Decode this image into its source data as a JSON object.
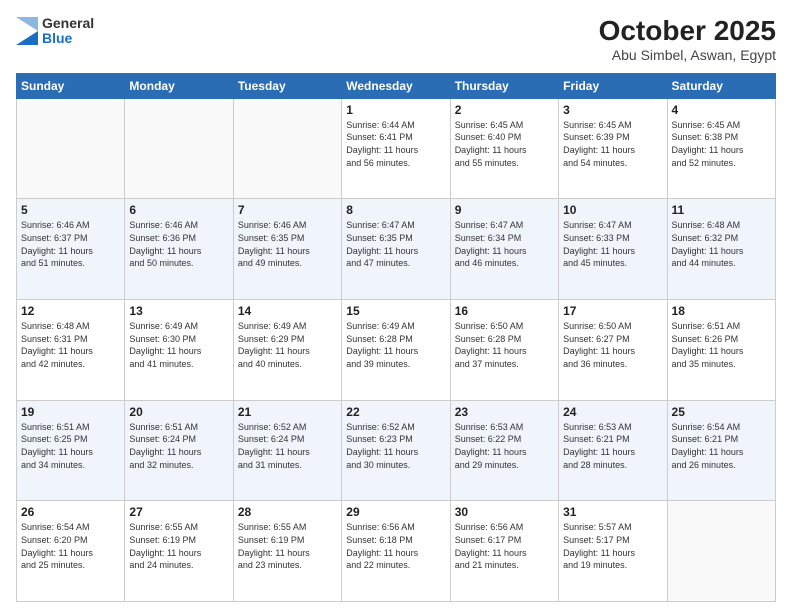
{
  "header": {
    "logo_general": "General",
    "logo_blue": "Blue",
    "month_title": "October 2025",
    "subtitle": "Abu Simbel, Aswan, Egypt"
  },
  "calendar": {
    "days_of_week": [
      "Sunday",
      "Monday",
      "Tuesday",
      "Wednesday",
      "Thursday",
      "Friday",
      "Saturday"
    ],
    "weeks": [
      [
        {
          "day": "",
          "info": ""
        },
        {
          "day": "",
          "info": ""
        },
        {
          "day": "",
          "info": ""
        },
        {
          "day": "1",
          "info": "Sunrise: 6:44 AM\nSunset: 6:41 PM\nDaylight: 11 hours\nand 56 minutes."
        },
        {
          "day": "2",
          "info": "Sunrise: 6:45 AM\nSunset: 6:40 PM\nDaylight: 11 hours\nand 55 minutes."
        },
        {
          "day": "3",
          "info": "Sunrise: 6:45 AM\nSunset: 6:39 PM\nDaylight: 11 hours\nand 54 minutes."
        },
        {
          "day": "4",
          "info": "Sunrise: 6:45 AM\nSunset: 6:38 PM\nDaylight: 11 hours\nand 52 minutes."
        }
      ],
      [
        {
          "day": "5",
          "info": "Sunrise: 6:46 AM\nSunset: 6:37 PM\nDaylight: 11 hours\nand 51 minutes."
        },
        {
          "day": "6",
          "info": "Sunrise: 6:46 AM\nSunset: 6:36 PM\nDaylight: 11 hours\nand 50 minutes."
        },
        {
          "day": "7",
          "info": "Sunrise: 6:46 AM\nSunset: 6:35 PM\nDaylight: 11 hours\nand 49 minutes."
        },
        {
          "day": "8",
          "info": "Sunrise: 6:47 AM\nSunset: 6:35 PM\nDaylight: 11 hours\nand 47 minutes."
        },
        {
          "day": "9",
          "info": "Sunrise: 6:47 AM\nSunset: 6:34 PM\nDaylight: 11 hours\nand 46 minutes."
        },
        {
          "day": "10",
          "info": "Sunrise: 6:47 AM\nSunset: 6:33 PM\nDaylight: 11 hours\nand 45 minutes."
        },
        {
          "day": "11",
          "info": "Sunrise: 6:48 AM\nSunset: 6:32 PM\nDaylight: 11 hours\nand 44 minutes."
        }
      ],
      [
        {
          "day": "12",
          "info": "Sunrise: 6:48 AM\nSunset: 6:31 PM\nDaylight: 11 hours\nand 42 minutes."
        },
        {
          "day": "13",
          "info": "Sunrise: 6:49 AM\nSunset: 6:30 PM\nDaylight: 11 hours\nand 41 minutes."
        },
        {
          "day": "14",
          "info": "Sunrise: 6:49 AM\nSunset: 6:29 PM\nDaylight: 11 hours\nand 40 minutes."
        },
        {
          "day": "15",
          "info": "Sunrise: 6:49 AM\nSunset: 6:28 PM\nDaylight: 11 hours\nand 39 minutes."
        },
        {
          "day": "16",
          "info": "Sunrise: 6:50 AM\nSunset: 6:28 PM\nDaylight: 11 hours\nand 37 minutes."
        },
        {
          "day": "17",
          "info": "Sunrise: 6:50 AM\nSunset: 6:27 PM\nDaylight: 11 hours\nand 36 minutes."
        },
        {
          "day": "18",
          "info": "Sunrise: 6:51 AM\nSunset: 6:26 PM\nDaylight: 11 hours\nand 35 minutes."
        }
      ],
      [
        {
          "day": "19",
          "info": "Sunrise: 6:51 AM\nSunset: 6:25 PM\nDaylight: 11 hours\nand 34 minutes."
        },
        {
          "day": "20",
          "info": "Sunrise: 6:51 AM\nSunset: 6:24 PM\nDaylight: 11 hours\nand 32 minutes."
        },
        {
          "day": "21",
          "info": "Sunrise: 6:52 AM\nSunset: 6:24 PM\nDaylight: 11 hours\nand 31 minutes."
        },
        {
          "day": "22",
          "info": "Sunrise: 6:52 AM\nSunset: 6:23 PM\nDaylight: 11 hours\nand 30 minutes."
        },
        {
          "day": "23",
          "info": "Sunrise: 6:53 AM\nSunset: 6:22 PM\nDaylight: 11 hours\nand 29 minutes."
        },
        {
          "day": "24",
          "info": "Sunrise: 6:53 AM\nSunset: 6:21 PM\nDaylight: 11 hours\nand 28 minutes."
        },
        {
          "day": "25",
          "info": "Sunrise: 6:54 AM\nSunset: 6:21 PM\nDaylight: 11 hours\nand 26 minutes."
        }
      ],
      [
        {
          "day": "26",
          "info": "Sunrise: 6:54 AM\nSunset: 6:20 PM\nDaylight: 11 hours\nand 25 minutes."
        },
        {
          "day": "27",
          "info": "Sunrise: 6:55 AM\nSunset: 6:19 PM\nDaylight: 11 hours\nand 24 minutes."
        },
        {
          "day": "28",
          "info": "Sunrise: 6:55 AM\nSunset: 6:19 PM\nDaylight: 11 hours\nand 23 minutes."
        },
        {
          "day": "29",
          "info": "Sunrise: 6:56 AM\nSunset: 6:18 PM\nDaylight: 11 hours\nand 22 minutes."
        },
        {
          "day": "30",
          "info": "Sunrise: 6:56 AM\nSunset: 6:17 PM\nDaylight: 11 hours\nand 21 minutes."
        },
        {
          "day": "31",
          "info": "Sunrise: 5:57 AM\nSunset: 5:17 PM\nDaylight: 11 hours\nand 19 minutes."
        },
        {
          "day": "",
          "info": ""
        }
      ]
    ]
  }
}
